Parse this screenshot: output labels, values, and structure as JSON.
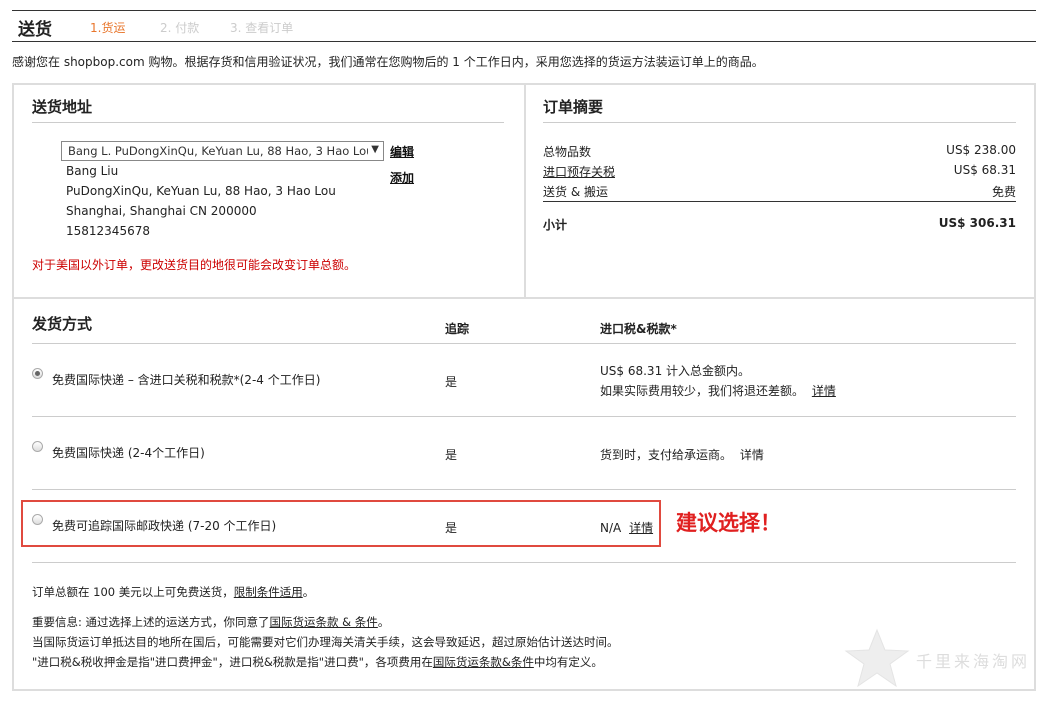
{
  "header": {
    "title": "送货",
    "steps": [
      "1.货运",
      "2. 付款",
      "3. 查看订单"
    ]
  },
  "intro": "感谢您在 shopbop.com 购物。根据存货和信用验证状况，我们通常在您购物后的 1 个工作日内，采用您选择的货运方法装运订单上的商品。",
  "address": {
    "title": "送货地址",
    "selected": "Bang L. PuDongXinQu, KeYuan Lu, 88 Hao, 3 Hao Lou",
    "lines": [
      "Bang Liu",
      "PuDongXinQu, KeYuan Lu, 88 Hao, 3 Hao Lou",
      "Shanghai, Shanghai CN 200000",
      "15812345678"
    ],
    "edit_label": "编辑",
    "add_label": "添加",
    "warning": "对于美国以外订单，更改送货目的地很可能会改变订单总额。"
  },
  "summary": {
    "title": "订单摘要",
    "rows": [
      {
        "label": "总物品数",
        "value": "US$ 238.00"
      },
      {
        "label": "进口预存关税",
        "value": "US$ 68.31"
      },
      {
        "label": "送货 & 搬运",
        "value": "免费"
      }
    ],
    "subtotal_label": "小计",
    "subtotal_value": "US$ 306.31"
  },
  "shipping": {
    "title": "发货方式",
    "col_tracking": "追踪",
    "col_tax": "进口税&税款*",
    "options": [
      {
        "label": "免费国际快递 – 含进口关税和税款*(2-4 个工作日)",
        "tracking": "是",
        "tax_line1": "US$ 68.31 计入总金额内。",
        "tax_line2": "如果实际费用较少，我们将退还差额。",
        "detail": "详情",
        "selected": true
      },
      {
        "label": "免费国际快递 (2-4个工作日)",
        "tracking": "是",
        "tax_line1": "货到时，支付给承运商。",
        "detail": "详情",
        "selected": false
      },
      {
        "label": "免费可追踪国际邮政快递 (7-20 个工作日)",
        "tracking": "是",
        "tax_line1": "N/A",
        "detail": "详情",
        "selected": false
      }
    ],
    "suggest": "建议选择！"
  },
  "footer": {
    "free_ship_pre": "订单总额在 100 美元以上可免费送货，",
    "free_ship_link": "限制条件适用",
    "free_ship_post": "。",
    "important_pre": "重要信息: 通过选择上述的运送方式，你同意了",
    "important_link": "国际货运条款 & 条件",
    "important_post": "。",
    "customs_note": "当国际货运订单抵达目的地所在国后，可能需要对它们办理海关清关手续，这会导致延迟，超过原始估计送达时间。",
    "def_pre": "\"进口税&税收押金是指\"进口费押金\"，进口税&税款是指\"进口费\"，各项费用在",
    "def_link": "国际货运条款&条件",
    "def_post": "中均有定义。"
  },
  "watermark": "千里来海淘网",
  "colors": {
    "accent": "#e8762c",
    "warning": "#cc0000",
    "highlight": "#e04a3f"
  }
}
